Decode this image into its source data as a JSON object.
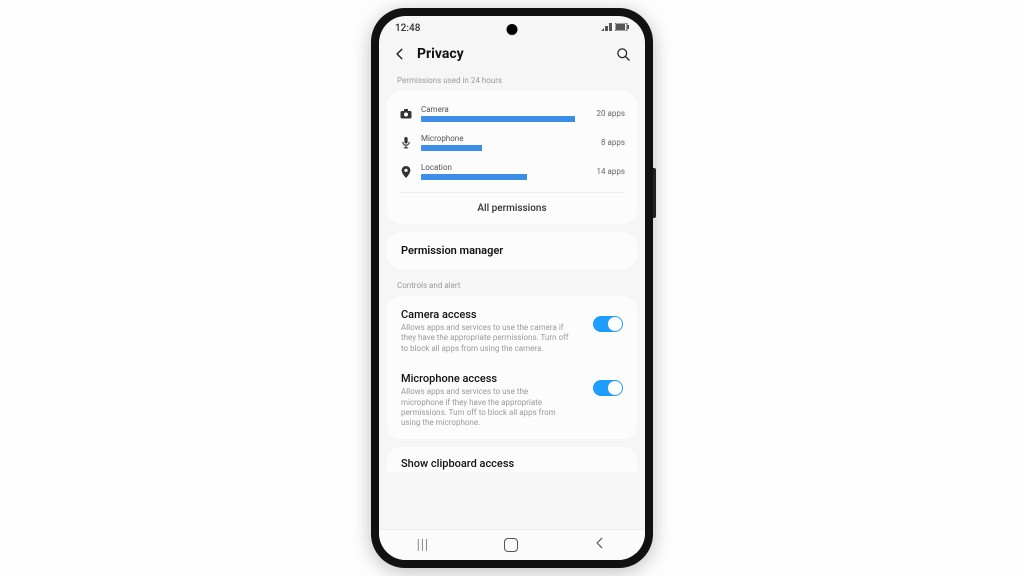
{
  "status": {
    "time": "12:48"
  },
  "header": {
    "title": "Privacy"
  },
  "permissions": {
    "heading": "Permissions used in 24 hours",
    "items": [
      {
        "label": "Camera",
        "count": "20 apps",
        "pct": 96
      },
      {
        "label": "Microphone",
        "count": "8 apps",
        "pct": 38
      },
      {
        "label": "Location",
        "count": "14 apps",
        "pct": 66
      }
    ],
    "all": "All permissions"
  },
  "permission_manager": "Permission manager",
  "controls": {
    "heading": "Controls and alert",
    "camera": {
      "title": "Camera access",
      "desc": "Allows apps and services to use the camera if they have the appropriate permissions. Turn off to block all apps from using the camera.",
      "on": true
    },
    "mic": {
      "title": "Microphone access",
      "desc": "Allows apps and services to use the microphone if they have the appropriate permissions. Turn off to block all apps from using the microphone.",
      "on": true
    },
    "clipboard": {
      "title": "Show clipboard access"
    }
  }
}
